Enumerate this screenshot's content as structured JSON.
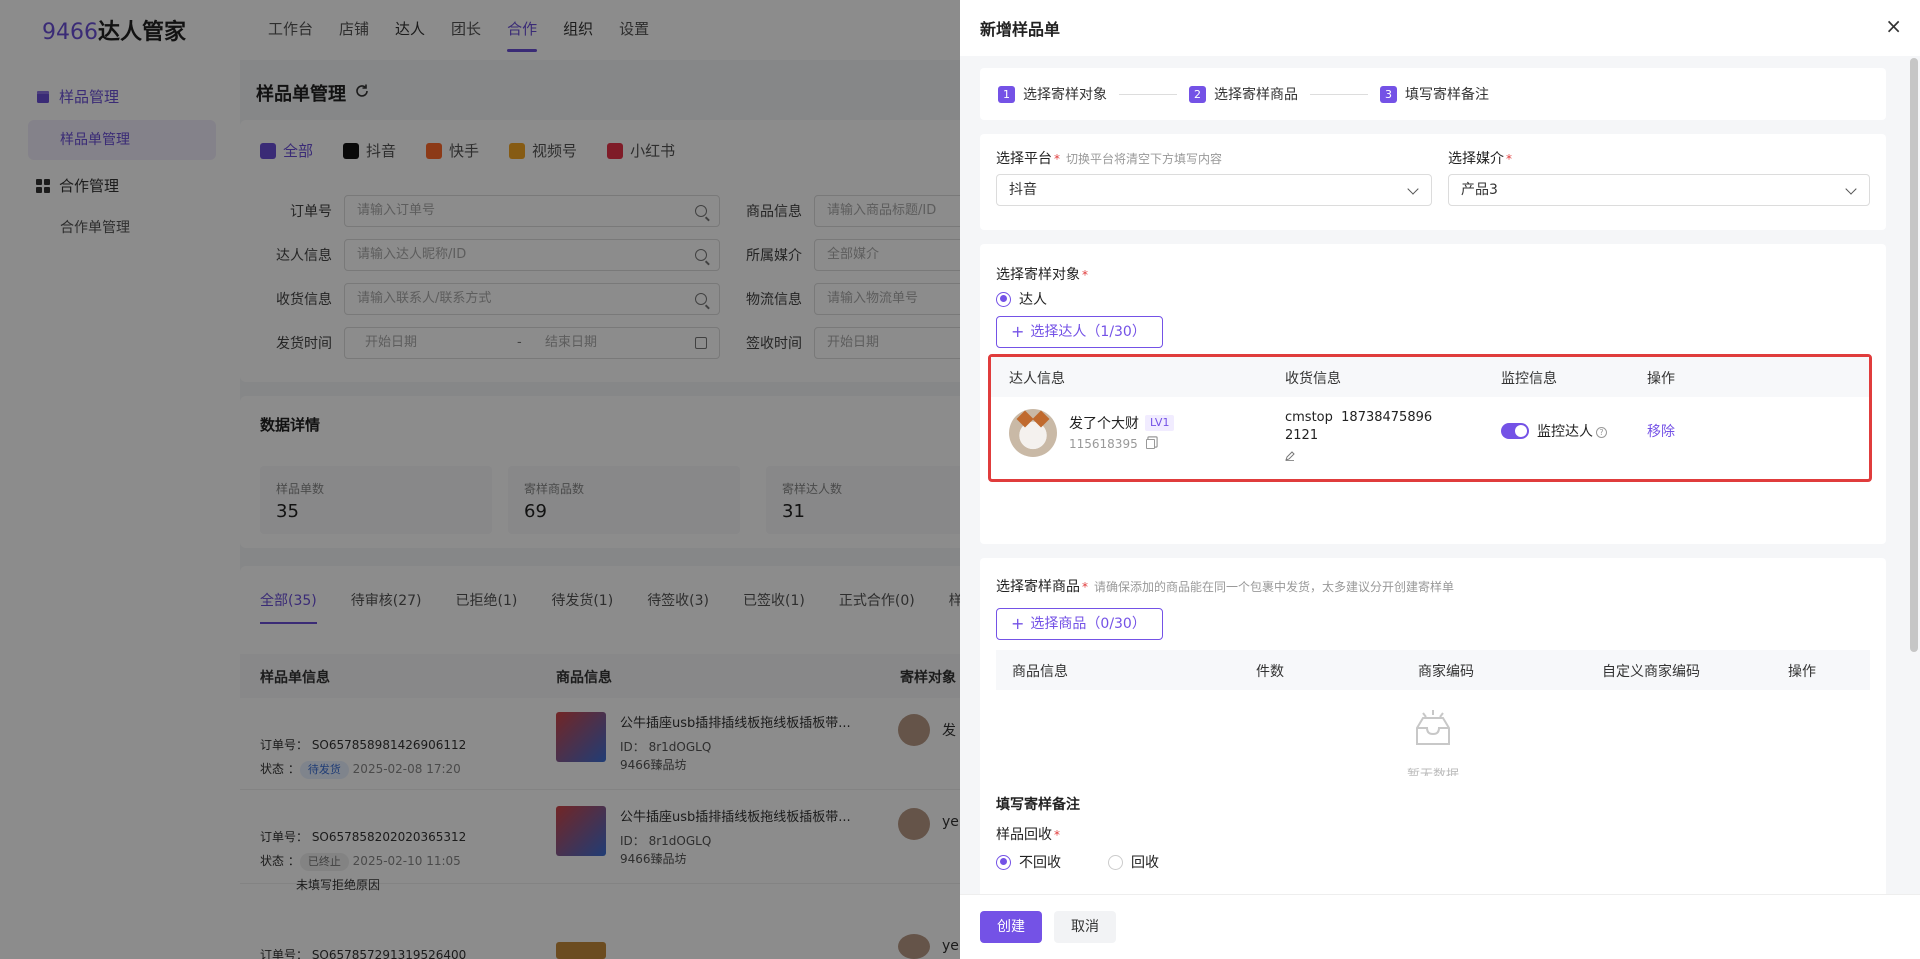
{
  "app": {
    "logo_num": "9466",
    "logo_text": "达人管家",
    "nav": [
      "工作台",
      "店铺",
      "达人",
      "团长",
      "合作",
      "组织",
      "设置"
    ],
    "active_nav": "合作"
  },
  "sidebar": {
    "group1": "样品管理",
    "item1": "样品单管理",
    "group2": "合作管理",
    "item2": "合作单管理"
  },
  "main": {
    "title": "样品单管理",
    "platform_tabs": [
      "全部",
      "抖音",
      "快手",
      "视频号",
      "小红书"
    ],
    "filters": {
      "order_no": {
        "label": "订单号",
        "placeholder": "请输入订单号"
      },
      "influencer": {
        "label": "达人信息",
        "placeholder": "请输入达人昵称/ID"
      },
      "receiver": {
        "label": "收货信息",
        "placeholder": "请输入联系人/联系方式"
      },
      "ship_time": {
        "label": "发货时间",
        "start": "开始日期",
        "sep": "-",
        "end": "结束日期"
      },
      "product": {
        "label": "商品信息",
        "placeholder": "请输入商品标题/ID"
      },
      "media": {
        "label": "所属媒介",
        "placeholder": "全部媒介"
      },
      "logistics": {
        "label": "物流信息",
        "placeholder": "请输入物流单号"
      },
      "sign_time": {
        "label": "签收时间",
        "placeholder": "开始日期"
      }
    },
    "stats_title": "数据详情",
    "stats": [
      {
        "label": "样品单数",
        "value": "35"
      },
      {
        "label": "寄样商品数",
        "value": "69"
      },
      {
        "label": "寄样达人数",
        "value": "31"
      }
    ],
    "order_tabs": [
      "全部(35)",
      "待审核(27)",
      "已拒绝(1)",
      "待发货(1)",
      "待签收(3)",
      "已签收(1)",
      "正式合作(0)",
      "样品回"
    ],
    "list_headers": [
      "样品单信息",
      "商品信息",
      "寄样对象"
    ],
    "rows": [
      {
        "order": "订单号：  SO657858981426906112",
        "status_label": "状态",
        "status": "待发货",
        "time": "2025-02-08 17:20",
        "note": "",
        "product": "公牛插座usb插排插线板拖线板插板带...",
        "pid": "ID：  8r1dOGLQ",
        "shop": "9466臻品坊",
        "who": "发"
      },
      {
        "order": "订单号：  SO657858202020365312",
        "status_label": "状态",
        "status": "已终止",
        "time": "2025-02-10 11:05",
        "note": "未填写拒绝原因",
        "product": "公牛插座usb插排插线板拖线板插板带...",
        "pid": "ID：  8r1dOGLQ",
        "shop": "9466臻品坊",
        "who": "ye"
      },
      {
        "order": "订单号：  SO657857291319526400",
        "status_label": "",
        "status": "",
        "time": "",
        "note": "",
        "product": "",
        "pid": "",
        "shop": "",
        "who": "ye"
      }
    ]
  },
  "drawer": {
    "title": "新增样品单",
    "close": "×",
    "steps": [
      {
        "num": "1",
        "label": "选择寄样对象"
      },
      {
        "num": "2",
        "label": "选择寄样商品"
      },
      {
        "num": "3",
        "label": "填写寄样备注"
      }
    ],
    "platform": {
      "label": "选择平台",
      "required": "*",
      "hint": "切换平台将清空下方填写内容",
      "value": "抖音"
    },
    "media": {
      "label": "选择媒介",
      "required": "*",
      "value": "产品3"
    },
    "target": {
      "label": "选择寄样对象",
      "required": "*",
      "radio": "达人",
      "button": "选择达人（1/30）",
      "headers": [
        "达人信息",
        "收货信息",
        "监控信息",
        "操作"
      ],
      "row": {
        "name": "发了个大财",
        "level": "LV1",
        "id": "115618395",
        "receiver_name": "cmstop",
        "receiver_phone": "18738475896",
        "receiver_addr": "2121",
        "monitor_label": "监控达人",
        "monitor_on": true,
        "action": "移除"
      }
    },
    "goods": {
      "label": "选择寄样商品",
      "required": "*",
      "hint": "请确保添加的商品能在同一个包裹中发货，太多建议分开创建寄样单",
      "button": "选择商品（0/30）",
      "headers": [
        "商品信息",
        "件数",
        "商家编码",
        "自定义商家编码",
        "操作"
      ],
      "empty": "暂无数据"
    },
    "remark": {
      "title": "填写寄样备注",
      "recycle_label": "样品回收",
      "required": "*",
      "options": [
        "不回收",
        "回收"
      ],
      "selected": "不回收"
    },
    "footer": {
      "create": "创建",
      "cancel": "取消"
    }
  },
  "colors": {
    "accent": "#7452e6",
    "highlight": "#e03c3c"
  }
}
